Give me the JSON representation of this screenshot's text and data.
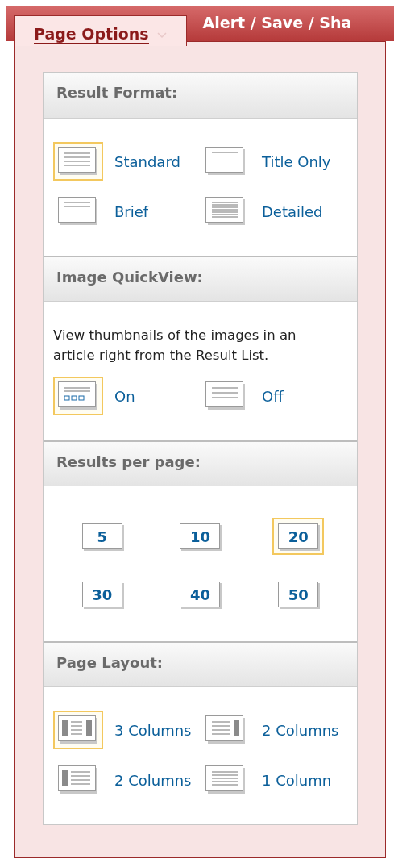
{
  "tabs": [
    {
      "label": "Page Options",
      "selected": true
    },
    {
      "label": "Alert / Save / Sha",
      "selected": false
    }
  ],
  "sections": [
    {
      "title": "Result Format:",
      "kind": "icons",
      "options": [
        {
          "label": "Standard",
          "kind": "standard",
          "selected": true
        },
        {
          "label": "Title Only",
          "kind": "title",
          "selected": false
        },
        {
          "label": "Brief",
          "kind": "brief",
          "selected": false
        },
        {
          "label": "Detailed",
          "kind": "detailed",
          "selected": false
        }
      ]
    },
    {
      "title": "Image QuickView:",
      "kind": "icons",
      "description": "View thumbnails of the images in an article right from the Result List.",
      "options": [
        {
          "label": "On",
          "kind": "images",
          "selected": true
        },
        {
          "label": "Off",
          "kind": "brief3",
          "selected": false
        }
      ]
    },
    {
      "title": "Results per page:",
      "kind": "numbers",
      "options": [
        {
          "label": "5",
          "selected": false
        },
        {
          "label": "10",
          "selected": false
        },
        {
          "label": "20",
          "selected": true
        },
        {
          "label": "30",
          "selected": false
        },
        {
          "label": "40",
          "selected": false
        },
        {
          "label": "50",
          "selected": false
        }
      ]
    },
    {
      "title": "Page Layout:",
      "kind": "icons",
      "options": [
        {
          "label": "3 Columns",
          "kind": "col3",
          "selected": true
        },
        {
          "label": "2 Columns",
          "kind": "col2right",
          "selected": false
        },
        {
          "label": "2 Columns",
          "kind": "col2left",
          "selected": false
        },
        {
          "label": "1 Column",
          "kind": "col1",
          "selected": false
        }
      ]
    }
  ]
}
